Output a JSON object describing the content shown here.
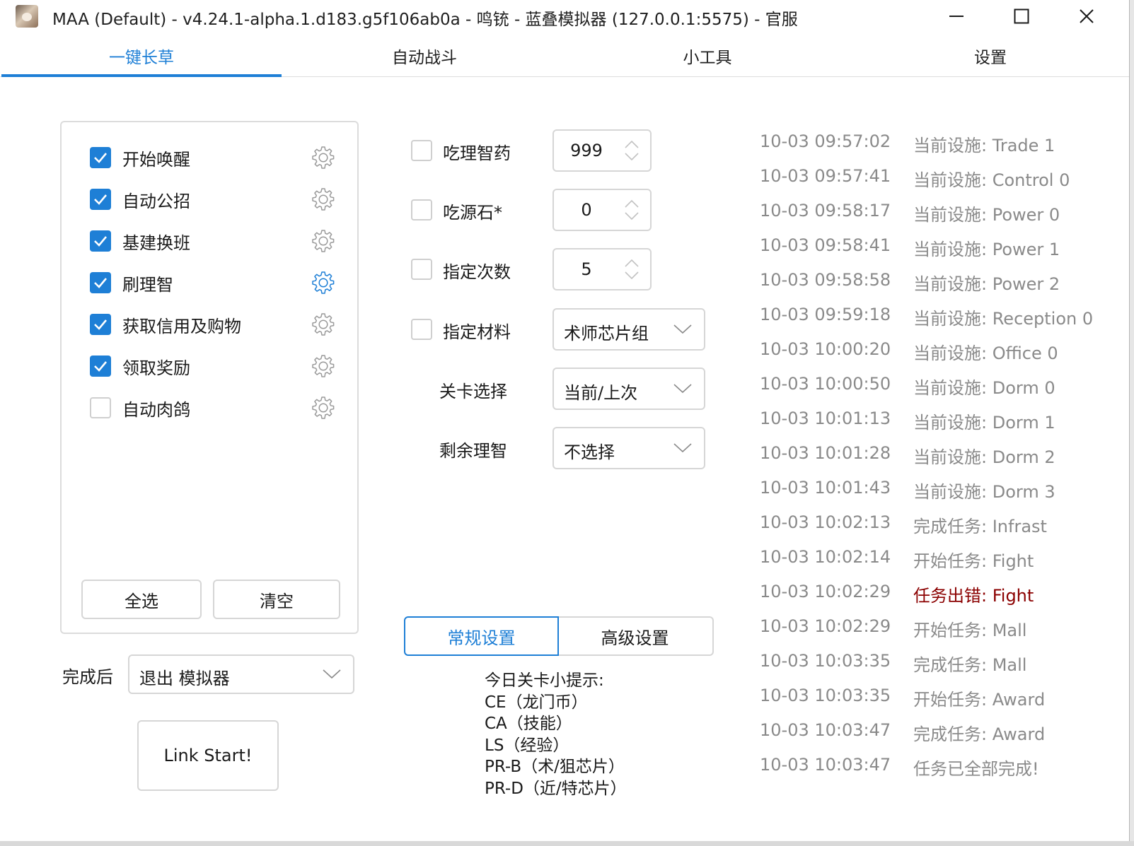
{
  "window": {
    "title": "MAA (Default) - v4.24.1-alpha.1.d183.g5f106ab0a - 鸣铳 - 蓝叠模拟器 (127.0.0.1:5575) - 官服",
    "controls": [
      "minimize-icon",
      "maximize-icon",
      "close-icon"
    ]
  },
  "tabs": [
    {
      "label": "一键长草",
      "active": true
    },
    {
      "label": "自动战斗",
      "active": false
    },
    {
      "label": "小工具",
      "active": false
    },
    {
      "label": "设置",
      "active": false
    }
  ],
  "tasks": [
    {
      "label": "开始唤醒",
      "checked": true,
      "gear_active": false
    },
    {
      "label": "自动公招",
      "checked": true,
      "gear_active": false
    },
    {
      "label": "基建换班",
      "checked": true,
      "gear_active": false
    },
    {
      "label": "刷理智",
      "checked": true,
      "gear_active": true
    },
    {
      "label": "获取信用及购物",
      "checked": true,
      "gear_active": false
    },
    {
      "label": "领取奖励",
      "checked": true,
      "gear_active": false
    },
    {
      "label": "自动肉鸽",
      "checked": false,
      "gear_active": false
    }
  ],
  "task_buttons": {
    "select_all": "全选",
    "clear": "清空"
  },
  "after_completion": {
    "label": "完成后",
    "value": "退出 模拟器"
  },
  "start_button": "Link Start!",
  "options": {
    "use_medicine": {
      "label": "吃理智药",
      "checked": false,
      "value": "999"
    },
    "use_stone": {
      "label": "吃源石*",
      "checked": false,
      "value": "0"
    },
    "times": {
      "label": "指定次数",
      "checked": false,
      "value": "5"
    },
    "drop_item": {
      "label": "指定材料",
      "checked": false,
      "value": "术师芯片组"
    },
    "stage": {
      "label": "关卡选择",
      "value": "当前/上次"
    },
    "remaining": {
      "label": "剩余理智",
      "value": "不选择"
    }
  },
  "settings_tabs": {
    "general": "常规设置",
    "advanced": "高级设置"
  },
  "tips": {
    "title": "今日关卡小提示:",
    "lines": [
      "CE（龙门币）",
      "CA（技能）",
      "LS（经验）",
      "PR-B（术/狙芯片）",
      "PR-D（近/特芯片）"
    ]
  },
  "log": [
    {
      "time": "10-03  09:57:02",
      "message": "当前设施: Trade 1"
    },
    {
      "time": "10-03  09:57:41",
      "message": "当前设施: Control 0"
    },
    {
      "time": "10-03  09:58:17",
      "message": "当前设施: Power 0"
    },
    {
      "time": "10-03  09:58:41",
      "message": "当前设施: Power 1"
    },
    {
      "time": "10-03  09:58:58",
      "message": "当前设施: Power 2"
    },
    {
      "time": "10-03  09:59:18",
      "message": "当前设施: Reception 0"
    },
    {
      "time": "10-03  10:00:20",
      "message": "当前设施: Office 0"
    },
    {
      "time": "10-03  10:00:50",
      "message": "当前设施: Dorm 0"
    },
    {
      "time": "10-03  10:01:13",
      "message": "当前设施: Dorm 1"
    },
    {
      "time": "10-03  10:01:28",
      "message": "当前设施: Dorm 2"
    },
    {
      "time": "10-03  10:01:43",
      "message": "当前设施: Dorm 3"
    },
    {
      "time": "10-03  10:02:13",
      "message": "完成任务: Infrast"
    },
    {
      "time": "10-03  10:02:14",
      "message": "开始任务: Fight"
    },
    {
      "time": "10-03  10:02:29",
      "message": "任务出错: Fight",
      "error": true
    },
    {
      "time": "10-03  10:02:29",
      "message": "开始任务: Mall"
    },
    {
      "time": "10-03  10:03:35",
      "message": "完成任务: Mall"
    },
    {
      "time": "10-03  10:03:35",
      "message": "开始任务: Award"
    },
    {
      "time": "10-03  10:03:47",
      "message": "完成任务: Award"
    },
    {
      "time": "10-03  10:03:47",
      "message": "任务已全部完成!"
    }
  ],
  "colors": {
    "accent": "#1e7fd6",
    "log_text": "#8a8a8a",
    "log_error": "#8b0000",
    "border": "#d6d6d6"
  }
}
